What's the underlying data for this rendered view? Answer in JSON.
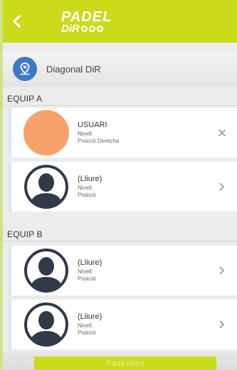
{
  "header": {
    "logo_line1": "PADEL",
    "logo_line2": "DiR",
    "back_icon": "chevron-left-icon",
    "bar_color": "#c9db1a"
  },
  "venue": {
    "name": "Diagonal DiR",
    "icon": "location-pin-icon",
    "icon_color": "#3d78c7"
  },
  "teams": [
    {
      "label": "EQUIP A",
      "players": [
        {
          "name": "USUARI",
          "level": "Nivell:",
          "position": "Posició Derecha",
          "avatar": "orange-avatar",
          "action": "close-icon"
        },
        {
          "name": "(Lliure)",
          "level": "Nivell:",
          "position": "Posició",
          "avatar": "person-silhouette-icon",
          "action": "chevron-right-icon"
        }
      ]
    },
    {
      "label": "EQUIP B",
      "players": [
        {
          "name": "(Lliure)",
          "level": "Nivell:",
          "position": "Posició",
          "avatar": "person-silhouette-icon",
          "action": "chevron-right-icon"
        },
        {
          "name": "(Lliure)",
          "level": "Nivell:",
          "position": "Posició",
          "avatar": "person-silhouette-icon",
          "action": "chevron-right-icon"
        }
      ]
    }
  ],
  "footer": {
    "button_label": "Partit obert"
  }
}
